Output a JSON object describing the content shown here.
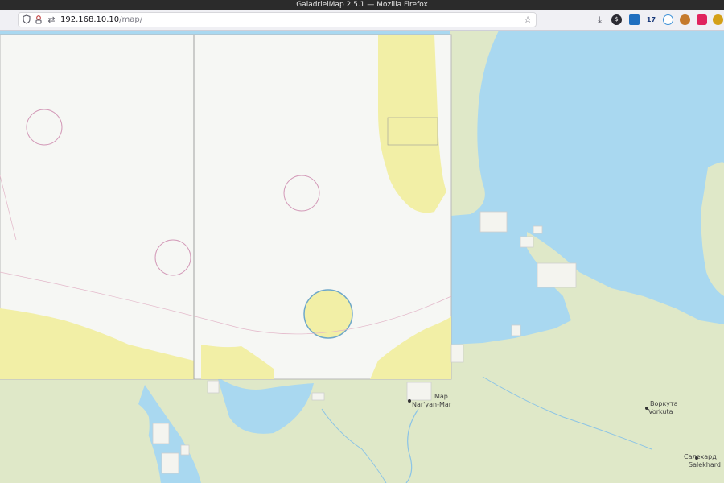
{
  "window": {
    "title": "GaladrielMap 2.5.1 — Mozilla Firefox"
  },
  "urlbar": {
    "host": "192.168.10.10",
    "path": "/map/"
  },
  "map": {
    "labels": {
      "naryan_mar_latin": "Nar'yan-Mar",
      "naryan_mar_map": "Map",
      "vorkuta_cyr": "Воркута",
      "vorkuta_latin": "Vorkuta",
      "salekhard_cyr": "Салехард",
      "salekhard_latin": "Salekhard"
    },
    "colors": {
      "sea": "#a9d8f0",
      "land": "#dfe8c8",
      "chart_paper": "#f6f7f4",
      "chart_land": "#f2efa6"
    }
  },
  "toolbar_icons": [
    "shield-icon",
    "permissions-icon",
    "connection-icon",
    "bookmark-star-icon",
    "downloads-icon",
    "extension-icon",
    "extension-icon",
    "extension-icon",
    "extension-icon",
    "extension-icon",
    "extension-icon",
    "extension-icon"
  ]
}
